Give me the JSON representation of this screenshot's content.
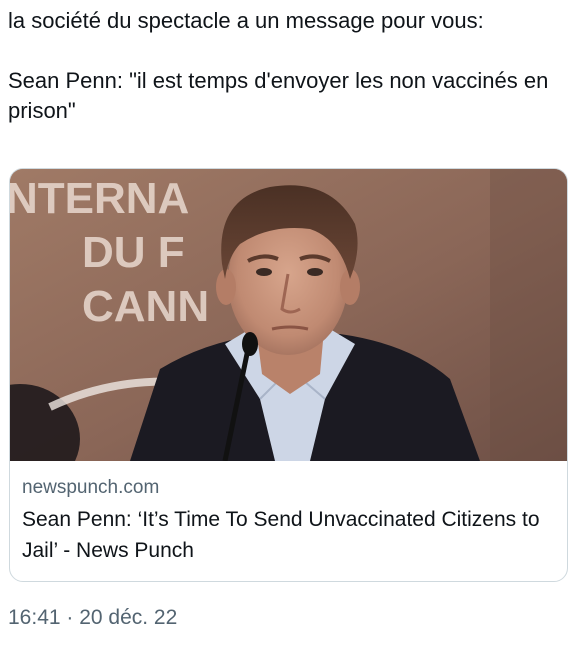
{
  "tweet": {
    "line1": "la société du spectacle a un message pour vous:",
    "line2": "Sean Penn: \"il est temps d'envoyer les non vaccinés en prison\""
  },
  "card": {
    "domain": "newspunch.com",
    "title": "Sean Penn: ‘It’s Time To Send Unvaccinated Citizens to Jail’ - News Punch",
    "image_backdrop_text": [
      "NTERNA",
      "DU F",
      "CANN"
    ]
  },
  "timestamp": "16:41 · 20 déc. 22",
  "colors": {
    "text": "#0f1419",
    "muted": "#536471",
    "card_border": "#cfd9de",
    "backdrop": "#8e6c5e"
  }
}
